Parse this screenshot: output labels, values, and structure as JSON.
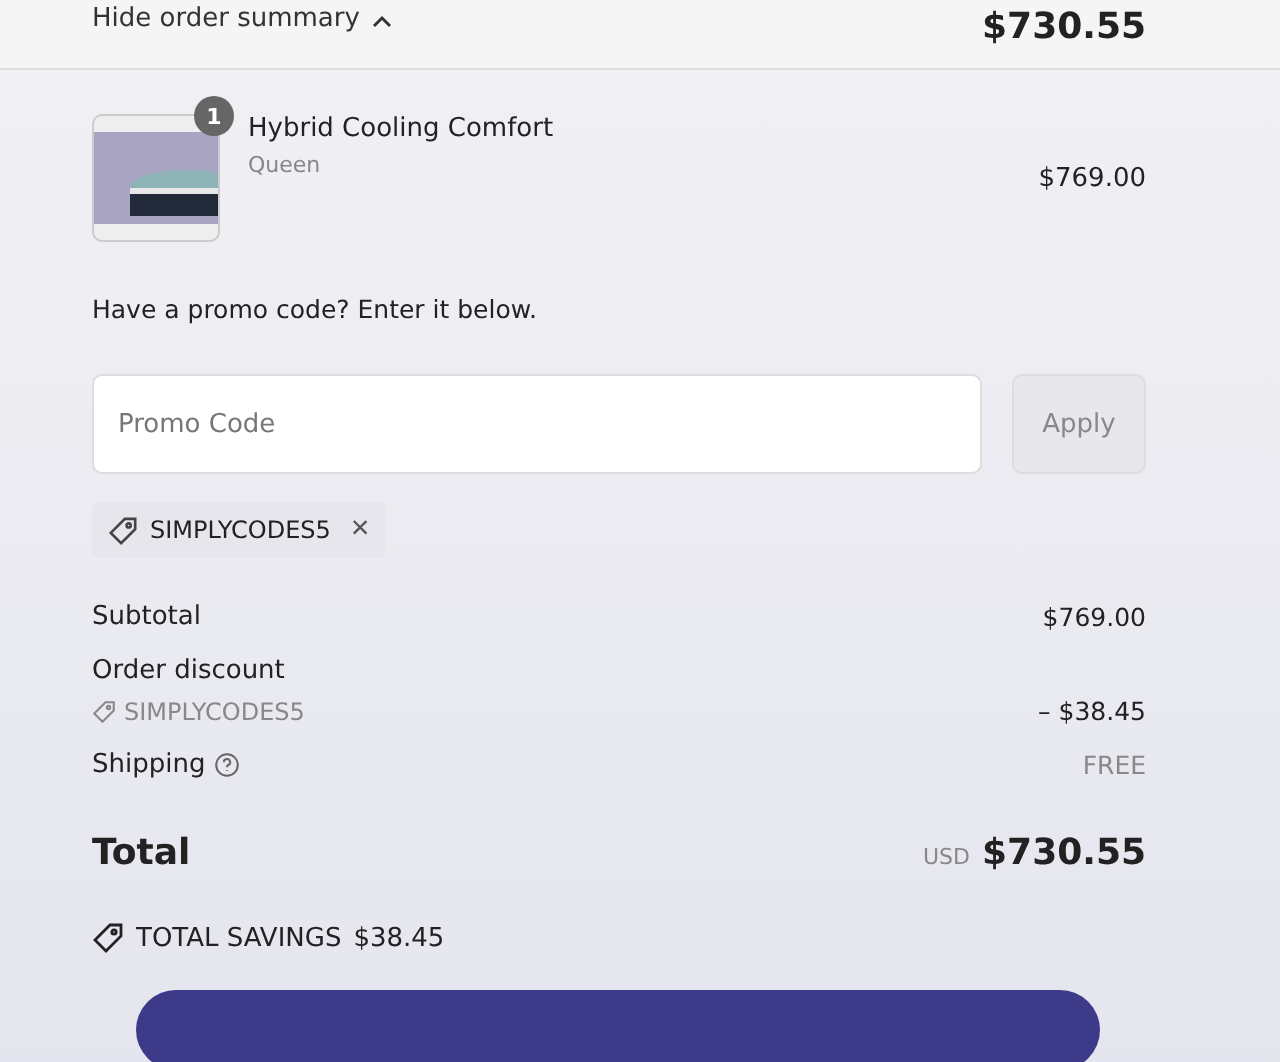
{
  "header": {
    "toggle_label": "Hide order summary",
    "expanded": true,
    "total": "$730.55"
  },
  "items": [
    {
      "name": "Hybrid Cooling Comfort",
      "variant": "Queen",
      "quantity": "1",
      "price": "$769.00"
    }
  ],
  "promo": {
    "prompt": "Have a promo code? Enter it below.",
    "placeholder": "Promo Code",
    "apply_label": "Apply",
    "apply_disabled": true,
    "applied_codes": [
      {
        "code": "SIMPLYCODES5",
        "remove_label": "×"
      }
    ]
  },
  "summary": {
    "lines": [
      {
        "kind": "plain",
        "label": "Subtotal",
        "value": "$769.00"
      },
      {
        "kind": "discount",
        "label": "Order discount",
        "code": "SIMPLYCODES5",
        "value": "– $38.45"
      },
      {
        "kind": "info",
        "label": "Shipping",
        "value": "FREE"
      }
    ],
    "total_label": "Total",
    "currency": "USD",
    "total": "$730.55",
    "savings_label": "TOTAL SAVINGS",
    "savings": "$38.45"
  }
}
